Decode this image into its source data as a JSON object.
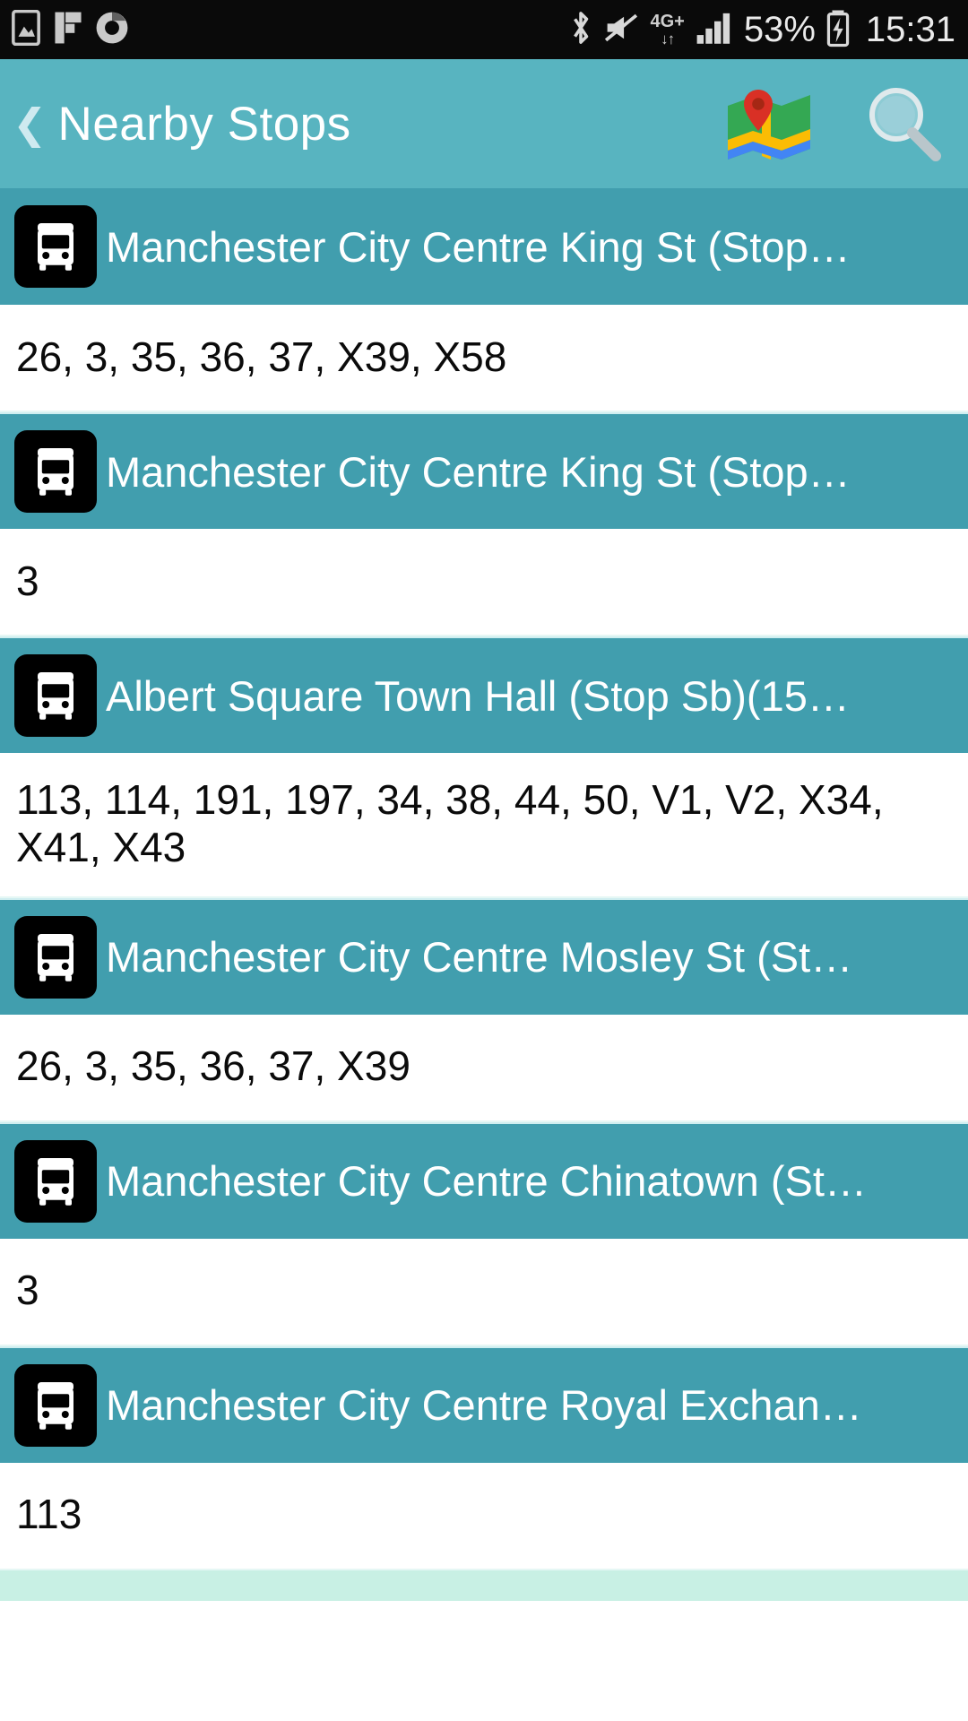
{
  "statusbar": {
    "time": "15:31",
    "battery_percent": "53%",
    "network_type": "4G+",
    "left_icons": [
      "image-icon",
      "flipboard-icon",
      "chrome-icon"
    ],
    "right_icons": [
      "bluetooth-icon",
      "mute-icon",
      "network-4g-icon",
      "signal-bars-icon",
      "battery-charging-icon"
    ]
  },
  "appbar": {
    "back_label": "❮",
    "title": "Nearby Stops",
    "map_icon": "map-icon",
    "search_icon": "search-icon"
  },
  "list": {
    "stops": [
      {
        "name": "Manchester City Centre King St (Stop…",
        "routes": "26, 3, 35, 36, 37, X39, X58",
        "icon": "bus-icon"
      },
      {
        "name": "Manchester City Centre King St (Stop…",
        "routes": "3",
        "icon": "bus-icon"
      },
      {
        "name": "Albert Square Town Hall (Stop Sb)(15…",
        "routes": "113, 114, 191, 197, 34, 38, 44, 50, V1, V2, X34, X41, X43",
        "icon": "bus-icon"
      },
      {
        "name": "Manchester City Centre Mosley St (St…",
        "routes": "26, 3, 35, 36, 37, X39",
        "icon": "bus-icon"
      },
      {
        "name": "Manchester City Centre Chinatown (St…",
        "routes": "3",
        "icon": "bus-icon"
      },
      {
        "name": "Manchester City Centre Royal Exchan…",
        "routes": "113",
        "icon": "bus-icon"
      }
    ]
  },
  "colors": {
    "appbar_bg": "#58b4c0",
    "stop_row_bg": "#419eae",
    "routes_row_bg": "#ffffff",
    "statusbar_bg": "#0a0a0a",
    "bottom_strip": "#c8f0e4",
    "title_text": "#ffffff"
  }
}
